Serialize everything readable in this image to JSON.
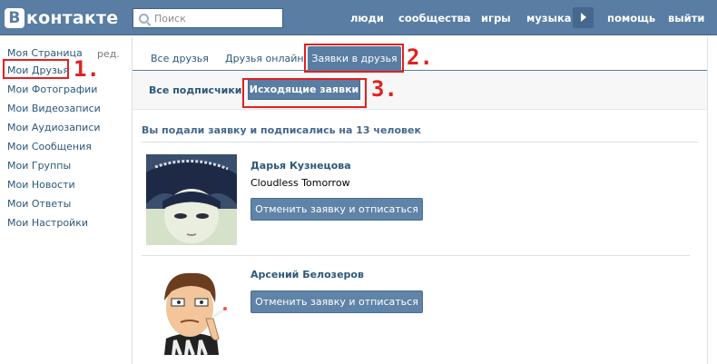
{
  "header": {
    "logo_letter": "В",
    "logo_text": "контакте",
    "search_placeholder": "Поиск",
    "nav": [
      "люди",
      "сообщества",
      "игры",
      "музыка",
      "помощь",
      "выйти"
    ]
  },
  "sidebar": {
    "items": [
      {
        "label": "Моя Страница"
      },
      {
        "label": "Мои Друзья"
      },
      {
        "label": "Мои Фотографии"
      },
      {
        "label": "Мои Видеозаписи"
      },
      {
        "label": "Мои Аудиозаписи"
      },
      {
        "label": "Мои Сообщения"
      },
      {
        "label": "Мои Группы"
      },
      {
        "label": "Мои Новости"
      },
      {
        "label": "Мои Ответы"
      },
      {
        "label": "Мои Настройки"
      }
    ],
    "edit_label": "ред."
  },
  "tabs": [
    "Все друзья",
    "Друзья онлайн",
    "Заявки в друзья"
  ],
  "subtabs": [
    "Все подписчики",
    "Исходящие заявки"
  ],
  "section_title": "Вы подали заявку и подписались на 13 человек",
  "users": [
    {
      "name": "Дарья Кузнецова",
      "status": "Cloudless Tomorrow",
      "button": "Отменить заявку и отписаться"
    },
    {
      "name": "Арсений Белозеров",
      "status": "",
      "button": "Отменить заявку и отписаться"
    }
  ],
  "annotations": [
    "1.",
    "2.",
    "3."
  ],
  "colors": {
    "header_bg": "#597da3",
    "link": "#2b587a",
    "highlight": "#e32020",
    "button": "#6083a8"
  }
}
